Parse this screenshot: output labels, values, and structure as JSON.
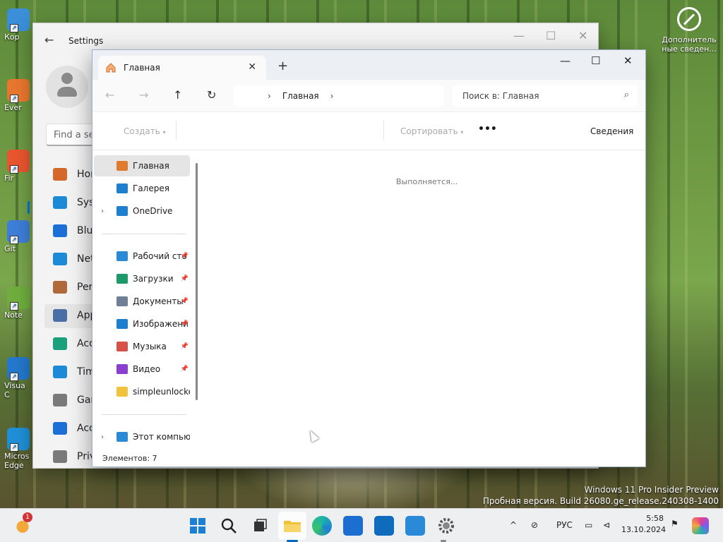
{
  "desktop": {
    "icons": [
      {
        "label": "Кор",
        "color": "#3a8fd8"
      },
      {
        "label": "Ever",
        "color": "#e8772e"
      },
      {
        "label": "Fir",
        "color": "#e8552e"
      },
      {
        "label": "Git",
        "color": "#3d7ed8"
      },
      {
        "label": "Note",
        "color": "#6fae3e"
      },
      {
        "label": "Visua\nC",
        "color": "#2478cc"
      },
      {
        "label": "Micros\nEdge",
        "color": "#1f8fd6"
      }
    ],
    "info_label": "Дополнитель ные сведен...",
    "watermark_line1": "Windows 11 Pro Insider Preview",
    "watermark_line2": "Пробная версия. Build 26080.ge_release.240308-1400"
  },
  "settings": {
    "title": "Settings",
    "search_placeholder": "Find a se",
    "nav": [
      {
        "label": "Hom",
        "icon": "home-icon",
        "color": "#d4682b"
      },
      {
        "label": "Syst",
        "icon": "monitor-icon",
        "color": "#1d8ad8"
      },
      {
        "label": "Blue",
        "icon": "bluetooth-icon",
        "color": "#1d6fd8"
      },
      {
        "label": "Net",
        "icon": "wifi-icon",
        "color": "#1d8ad8"
      },
      {
        "label": "Pers",
        "icon": "brush-icon",
        "color": "#b06a3a"
      },
      {
        "label": "App",
        "icon": "apps-icon",
        "color": "#4a6fa5"
      },
      {
        "label": "Acc",
        "icon": "accounts-icon",
        "color": "#1aa07a"
      },
      {
        "label": "Tim",
        "icon": "clock-icon",
        "color": "#1d8ad8"
      },
      {
        "label": "Gar",
        "icon": "gamepad-icon",
        "color": "#7a7a7a"
      },
      {
        "label": "Acc",
        "icon": "accessibility-icon",
        "color": "#1d6fd8"
      },
      {
        "label": "Priv",
        "icon": "shield-icon",
        "color": "#7a7a7a"
      }
    ]
  },
  "explorer": {
    "tab_label": "Главная",
    "breadcrumb": "Главная",
    "search_placeholder": "Поиск в: Главная",
    "cmd_create": "Создать",
    "cmd_sort": "Сортировать",
    "cmd_more": "•••",
    "cmd_details": "Сведения",
    "loading": "Выполняется...",
    "status": "Элементов: 7",
    "sidebar_top": [
      {
        "label": "Главная",
        "icon": "home-icon",
        "color": "#e07a2e"
      },
      {
        "label": "Галерея",
        "icon": "gallery-icon",
        "color": "#1d7fd0"
      },
      {
        "label": "OneDrive",
        "icon": "cloud-icon",
        "color": "#1d7fd0"
      }
    ],
    "sidebar_quick": [
      {
        "label": "Рабочий сто",
        "icon": "desktop-folder-icon",
        "color": "#2a8ad8"
      },
      {
        "label": "Загрузки",
        "icon": "download-icon",
        "color": "#1c9a6a"
      },
      {
        "label": "Документы",
        "icon": "document-icon",
        "color": "#6e7f96"
      },
      {
        "label": "Изображени",
        "icon": "pictures-icon",
        "color": "#1d7fd0"
      },
      {
        "label": "Музыка",
        "icon": "music-icon",
        "color": "#d8504a"
      },
      {
        "label": "Видео",
        "icon": "video-icon",
        "color": "#8a3fd0"
      },
      {
        "label": "simpleunlocker_",
        "icon": "folder-icon",
        "color": "#f2c23a"
      }
    ],
    "sidebar_bottom": {
      "label": "Этот компьюте",
      "icon": "computer-icon",
      "color": "#2a8ad8"
    }
  },
  "taskbar": {
    "notification_count": "1",
    "lang": "РУС",
    "time": "5:58",
    "date": "13.10.2024"
  }
}
